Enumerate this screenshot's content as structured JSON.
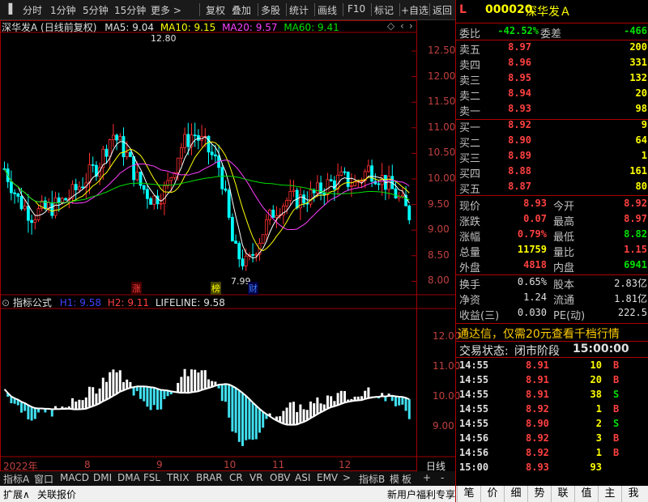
{
  "toolbar": {
    "left_items": [
      "分时",
      "1分钟",
      "5分钟",
      "15分钟",
      "更多 >"
    ],
    "right_items": [
      "复权",
      "叠加",
      "多股",
      "统计",
      "画线",
      "F10",
      "标记",
      "+自选",
      "返回"
    ]
  },
  "chart_header": {
    "title": "深华发A (日线前复权)",
    "ma5": "MA5: 9.04",
    "ma10": "MA10: 9.15",
    "ma20": "MA20: 9.57",
    "ma60": "MA60: 9.41",
    "high_label": "12.80",
    "low_label": "7.99",
    "price_ticks": [
      "12.50",
      "12.00",
      "11.50",
      "11.00",
      "10.50",
      "10.00",
      "9.50",
      "9.00",
      "8.50",
      "8.00"
    ],
    "markers": [
      "涨",
      "榜",
      "财"
    ]
  },
  "indicator": {
    "title": "指标公式",
    "h1": "H1: 9.58",
    "h2": "H2: 9.11",
    "lifeline": "LIFELINE: 9.58",
    "ticks": [
      "12.00",
      "11.00",
      "10.00",
      "9.00"
    ]
  },
  "time_axis": {
    "labels": [
      "2022年",
      "8",
      "9",
      "10",
      "11",
      "12"
    ],
    "period": "日线"
  },
  "bottom_tabs": [
    "指标A",
    "窗口",
    "MACD",
    "DMI",
    "DMA",
    "FSL",
    "TRIX",
    "BRAR",
    "CR",
    "VR",
    "OBV",
    "ASI",
    "EMV",
    ">",
    "指标B",
    "模",
    "板",
    "+",
    "-"
  ],
  "status_bar": {
    "left": [
      "扩展∧",
      "关联报价"
    ],
    "promo": "新用户福利专享",
    "right_tabs": [
      "笔",
      "价",
      "细",
      "势",
      "联",
      "值",
      "主",
      "我"
    ]
  },
  "quote": {
    "code": "000020",
    "name": "深华发Ａ",
    "L": "L",
    "weibi_label": "委比",
    "weibi": "-42.52%",
    "weicha_label": "委差",
    "weicha": "-466",
    "asks": [
      {
        "label": "卖五",
        "price": "8.97",
        "vol": "200"
      },
      {
        "label": "卖四",
        "price": "8.96",
        "vol": "331"
      },
      {
        "label": "卖三",
        "price": "8.95",
        "vol": "132"
      },
      {
        "label": "卖二",
        "price": "8.94",
        "vol": "20"
      },
      {
        "label": "卖一",
        "price": "8.93",
        "vol": "98"
      }
    ],
    "bids": [
      {
        "label": "买一",
        "price": "8.92",
        "vol": "9"
      },
      {
        "label": "买二",
        "price": "8.90",
        "vol": "64"
      },
      {
        "label": "买三",
        "price": "8.89",
        "vol": "1"
      },
      {
        "label": "买四",
        "price": "8.88",
        "vol": "161"
      },
      {
        "label": "买五",
        "price": "8.87",
        "vol": "80"
      }
    ],
    "stats": [
      {
        "l1": "现价",
        "v1": "8.93",
        "l2": "今开",
        "v2": "8.92",
        "c1": "red",
        "c2": "red"
      },
      {
        "l1": "涨跌",
        "v1": "0.07",
        "l2": "最高",
        "v2": "8.97",
        "c1": "red",
        "c2": "red"
      },
      {
        "l1": "涨幅",
        "v1": "0.79%",
        "l2": "最低",
        "v2": "8.82",
        "c1": "red",
        "c2": "green"
      },
      {
        "l1": "总量",
        "v1": "11759",
        "l2": "量比",
        "v2": "1.15",
        "c1": "yellow",
        "c2": "red"
      },
      {
        "l1": "外盘",
        "v1": "4818",
        "l2": "内盘",
        "v2": "6941",
        "c1": "red",
        "c2": "green"
      }
    ],
    "stats2": [
      {
        "l1": "换手",
        "v1": "0.65%",
        "l2": "股本",
        "v2": "2.83亿"
      },
      {
        "l1": "净资",
        "v1": "1.24",
        "l2": "流通",
        "v2": "1.81亿"
      },
      {
        "l1": "收益(三)",
        "v1": "0.030",
        "l2": "PE(动)",
        "v2": "222.5"
      }
    ],
    "promo": "通达信，仅需20元查看千档行情",
    "trade_status_label": "交易状态:",
    "trade_status": "闭市阶段",
    "trade_time": "15:00:00",
    "ticks": [
      {
        "t": "14:55",
        "p": "8.91",
        "v": "10",
        "s": "B",
        "pc": "red",
        "vc": "yellow",
        "sc": "red"
      },
      {
        "t": "14:55",
        "p": "8.91",
        "v": "20",
        "s": "B",
        "pc": "red",
        "vc": "yellow",
        "sc": "red"
      },
      {
        "t": "14:55",
        "p": "8.91",
        "v": "38",
        "s": "S",
        "pc": "red",
        "vc": "yellow",
        "sc": "green"
      },
      {
        "t": "14:55",
        "p": "8.92",
        "v": "1",
        "s": "B",
        "pc": "red",
        "vc": "yellow",
        "sc": "red"
      },
      {
        "t": "14:55",
        "p": "8.90",
        "v": "2",
        "s": "S",
        "pc": "red",
        "vc": "yellow",
        "sc": "green"
      },
      {
        "t": "14:56",
        "p": "8.92",
        "v": "3",
        "s": "B",
        "pc": "red",
        "vc": "yellow",
        "sc": "red"
      },
      {
        "t": "14:56",
        "p": "8.92",
        "v": "1",
        "s": "B",
        "pc": "red",
        "vc": "yellow",
        "sc": "red"
      },
      {
        "t": "15:00",
        "p": "8.93",
        "v": "93",
        "s": "",
        "pc": "red",
        "vc": "yellow",
        "sc": "red"
      }
    ]
  }
}
